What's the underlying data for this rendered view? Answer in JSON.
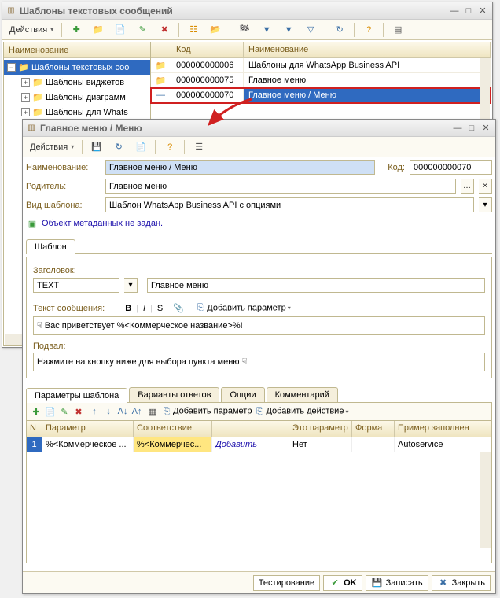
{
  "win1": {
    "title": "Шаблоны текстовых сообщений",
    "actions": "Действия",
    "tree_header": "Наименование",
    "tree": [
      {
        "label": "Шаблоны текстовых соо",
        "sel": true,
        "exp": "−",
        "indent": 0
      },
      {
        "label": "Шаблоны виджетов",
        "sel": false,
        "exp": "+",
        "indent": 1
      },
      {
        "label": "Шаблоны диаграмм",
        "sel": false,
        "exp": "+",
        "indent": 1
      },
      {
        "label": "Шаблоны для Whats",
        "sel": false,
        "exp": "+",
        "indent": 1
      }
    ],
    "grid_headers": {
      "code": "Код",
      "name": "Наименование"
    },
    "rows": [
      {
        "icon": "folder",
        "code": "000000000006",
        "name": "Шаблоны для WhatsApp Business API"
      },
      {
        "icon": "folder",
        "code": "000000000075",
        "name": "Главное меню"
      },
      {
        "icon": "item",
        "code": "000000000070",
        "name": "Главное меню / Меню",
        "sel": true
      }
    ]
  },
  "win2": {
    "title": "Главное меню / Меню",
    "actions": "Действия",
    "fields": {
      "name_label": "Наименование:",
      "name_value": "Главное меню / Меню",
      "code_label": "Код:",
      "code_value": "000000000070",
      "parent_label": "Родитель:",
      "parent_value": "Главное меню",
      "type_label": "Вид шаблона:",
      "type_value": "Шаблон WhatsApp Business API с опциями",
      "meta_link": "Объект метаданных не задан."
    },
    "tab1": "Шаблон",
    "section": {
      "header_label": "Заголовок:",
      "header_type": "TEXT",
      "header_value": "Главное меню",
      "msg_label": "Текст сообщения:",
      "format_b": "B",
      "format_i": "I",
      "format_s": "S",
      "add_param": "Добавить параметр",
      "msg_value": "☟ Вас приветствует %<Коммерческое название>%!",
      "footer_label": "Подвал:",
      "footer_value": "Нажмите на кнопку ниже для выбора пункта меню ☟"
    },
    "tabs2": [
      "Параметры шаблона",
      "Варианты ответов",
      "Опции",
      "Комментарий"
    ],
    "tb2": {
      "add_param": "Добавить параметр",
      "add_action": "Добавить действие"
    },
    "ptable": {
      "headers": {
        "n": "N",
        "param": "Параметр",
        "corr": "Соответствие",
        "blank": "",
        "isparam": "Это параметр",
        "fmt": "Формат",
        "example": "Пример заполнен"
      },
      "row": {
        "n": "1",
        "param": "%<Коммерческое ...",
        "corr": "%<Коммерчес...",
        "add": "Добавить",
        "isparam": "Нет",
        "fmt": "",
        "example": "Autoservice"
      }
    },
    "footer": {
      "test": "Тестирование",
      "ok": "OK",
      "save": "Записать",
      "close": "Закрыть"
    }
  }
}
